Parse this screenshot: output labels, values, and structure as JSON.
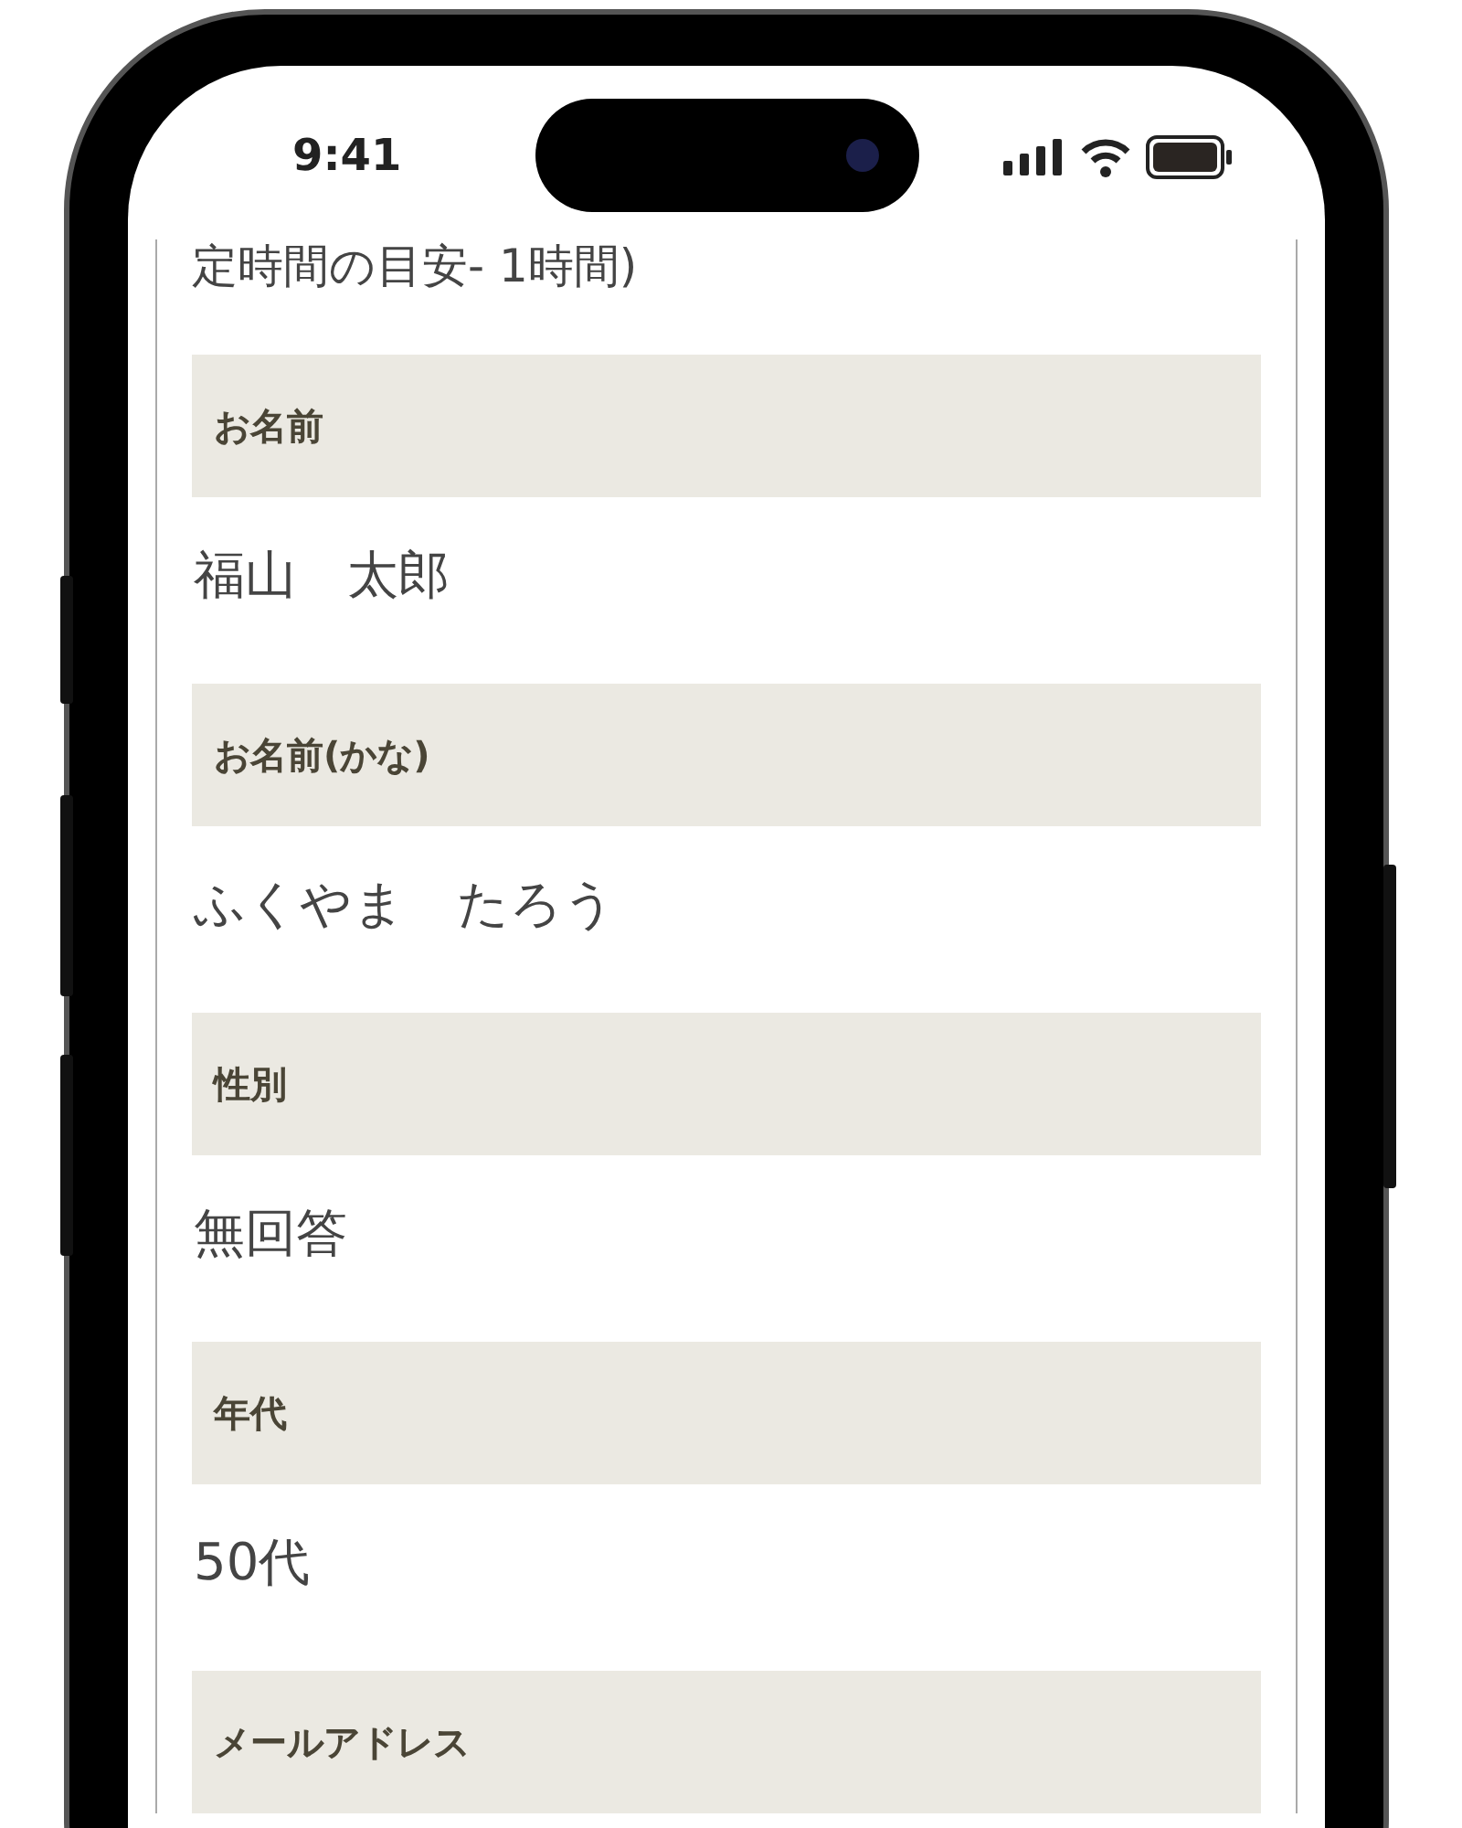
{
  "status_bar": {
    "time": "9:41"
  },
  "intro_text": "定時間の目安- 1時間)",
  "fields": [
    {
      "label": "お名前",
      "value": "福山　太郎"
    },
    {
      "label": "お名前(かな)",
      "value": "ふくやま　たろう"
    },
    {
      "label": "性別",
      "value": "無回答"
    },
    {
      "label": "年代",
      "value": "50代"
    },
    {
      "label": "メールアドレス"
    }
  ]
}
